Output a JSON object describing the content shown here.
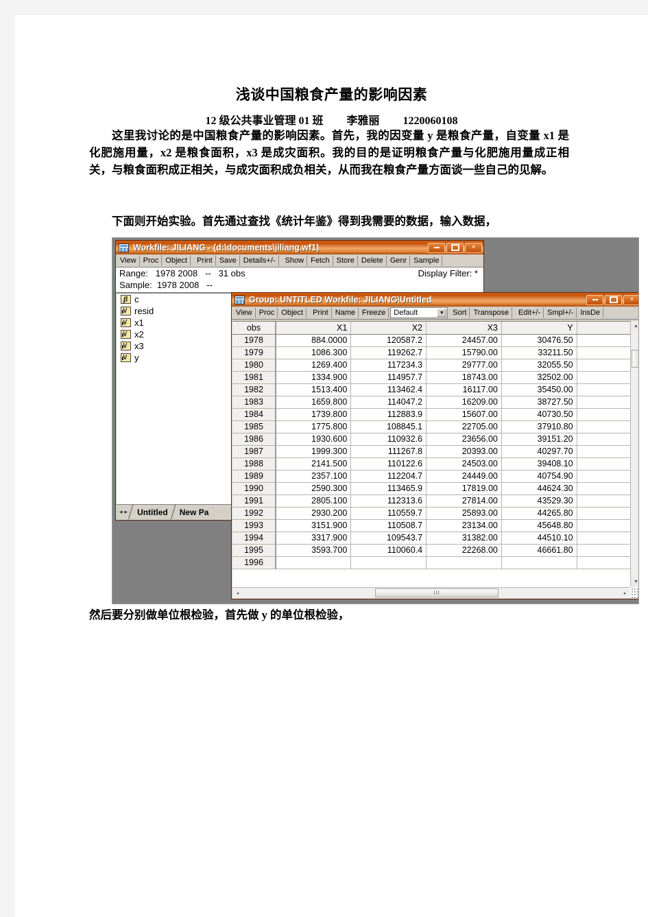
{
  "document": {
    "title": "浅谈中国粮食产量的影响因素",
    "byline_class": "12 级公共事业管理 01 班",
    "byline_name": "李雅丽",
    "byline_id": "1220060108",
    "para1": "这里我讨论的是中国粮食产量的影响因素。首先，我的因变量 y 是粮食产量，自变量 x1 是化肥施用量，x2 是粮食面积，x3 是成灾面积。我的目的是证明粮食产量与化肥施用量成正相关，与粮食面积成正相关，与成灾面积成负相关，从而我在粮食产量方面谈一些自己的见解。",
    "para2": "下面则开始实验。首先通过查找《统计年鉴》得到我需要的数据，输入数据，",
    "para3": "然后要分别做单位根检验，首先做 y 的单位根检验，"
  },
  "workfile_window": {
    "title": "Workfile: JILIANG - (d:\\documents\\jiliang.wf1)",
    "icon": "workfile-icon",
    "buttons": {
      "minimize": "–",
      "maximize": "▭",
      "close": "×"
    },
    "toolbar": [
      "View",
      "Proc",
      "Object",
      "Print",
      "Save",
      "Details+/-",
      "Show",
      "Fetch",
      "Store",
      "Delete",
      "Genr",
      "Sample"
    ],
    "range_label": "Range:",
    "range_value": "1978 2008",
    "range_dash": "--",
    "range_obs": "31 obs",
    "sample_label": "Sample:",
    "sample_value": "1978 2008",
    "sample_dash": "--",
    "display_filter": "Display Filter: *",
    "objects": [
      {
        "name": "c",
        "icon": "coefficient-icon"
      },
      {
        "name": "resid",
        "icon": "series-icon"
      },
      {
        "name": "x1",
        "icon": "series-icon"
      },
      {
        "name": "x2",
        "icon": "series-icon"
      },
      {
        "name": "x3",
        "icon": "series-icon"
      },
      {
        "name": "y",
        "icon": "series-icon"
      }
    ],
    "tabs": [
      "Untitled",
      "New Pa"
    ],
    "tab_arrow_left": "◂",
    "tab_arrow_right": "▸"
  },
  "group_window": {
    "title": "Group: UNTITLED   Workfile: JILIANG\\Untitled",
    "icon": "group-icon",
    "buttons": {
      "minimize": "–",
      "maximize": "▭",
      "close": "×"
    },
    "toolbar_left": [
      "View",
      "Proc",
      "Object",
      "Print",
      "Name",
      "Freeze"
    ],
    "view_select": "Default",
    "select_arrow": "▼",
    "toolbar_right": [
      "Sort",
      "Transpose",
      "Edit+/-",
      "Smpl+/-",
      "InsDe"
    ],
    "scroll": {
      "up_arrow": "▲",
      "down_arrow": "▼",
      "left_arrow": "◂",
      "right_arrow": "▸",
      "h_thumb_grip": "III"
    },
    "table": {
      "headers": [
        "obs",
        "X1",
        "X2",
        "X3",
        "Y",
        ""
      ],
      "rows": [
        [
          "1978",
          "884.0000",
          "120587.2",
          "24457.00",
          "30476.50",
          ""
        ],
        [
          "1979",
          "1086.300",
          "119262.7",
          "15790.00",
          "33211.50",
          ""
        ],
        [
          "1980",
          "1269.400",
          "117234.3",
          "29777.00",
          "32055.50",
          ""
        ],
        [
          "1981",
          "1334.900",
          "114957.7",
          "18743.00",
          "32502.00",
          ""
        ],
        [
          "1982",
          "1513.400",
          "113462.4",
          "16117.00",
          "35450.00",
          ""
        ],
        [
          "1983",
          "1659.800",
          "114047.2",
          "16209.00",
          "38727.50",
          ""
        ],
        [
          "1984",
          "1739.800",
          "112883.9",
          "15607.00",
          "40730.50",
          ""
        ],
        [
          "1985",
          "1775.800",
          "108845.1",
          "22705.00",
          "37910.80",
          ""
        ],
        [
          "1986",
          "1930.600",
          "110932.6",
          "23656.00",
          "39151.20",
          ""
        ],
        [
          "1987",
          "1999.300",
          "111267.8",
          "20393.00",
          "40297.70",
          ""
        ],
        [
          "1988",
          "2141.500",
          "110122.6",
          "24503.00",
          "39408.10",
          ""
        ],
        [
          "1989",
          "2357.100",
          "112204.7",
          "24449.00",
          "40754.90",
          ""
        ],
        [
          "1990",
          "2590.300",
          "113465.9",
          "17819.00",
          "44624.30",
          ""
        ],
        [
          "1991",
          "2805.100",
          "112313.6",
          "27814.00",
          "43529.30",
          ""
        ],
        [
          "1992",
          "2930.200",
          "110559.7",
          "25893.00",
          "44265.80",
          ""
        ],
        [
          "1993",
          "3151.900",
          "110508.7",
          "23134.00",
          "45648.80",
          ""
        ],
        [
          "1994",
          "3317.900",
          "109543.7",
          "31382.00",
          "44510.10",
          ""
        ],
        [
          "1995",
          "3593.700",
          "110060.4",
          "22268.00",
          "46661.80",
          ""
        ],
        [
          "1996",
          "",
          "",
          "",
          "",
          ""
        ]
      ]
    }
  }
}
